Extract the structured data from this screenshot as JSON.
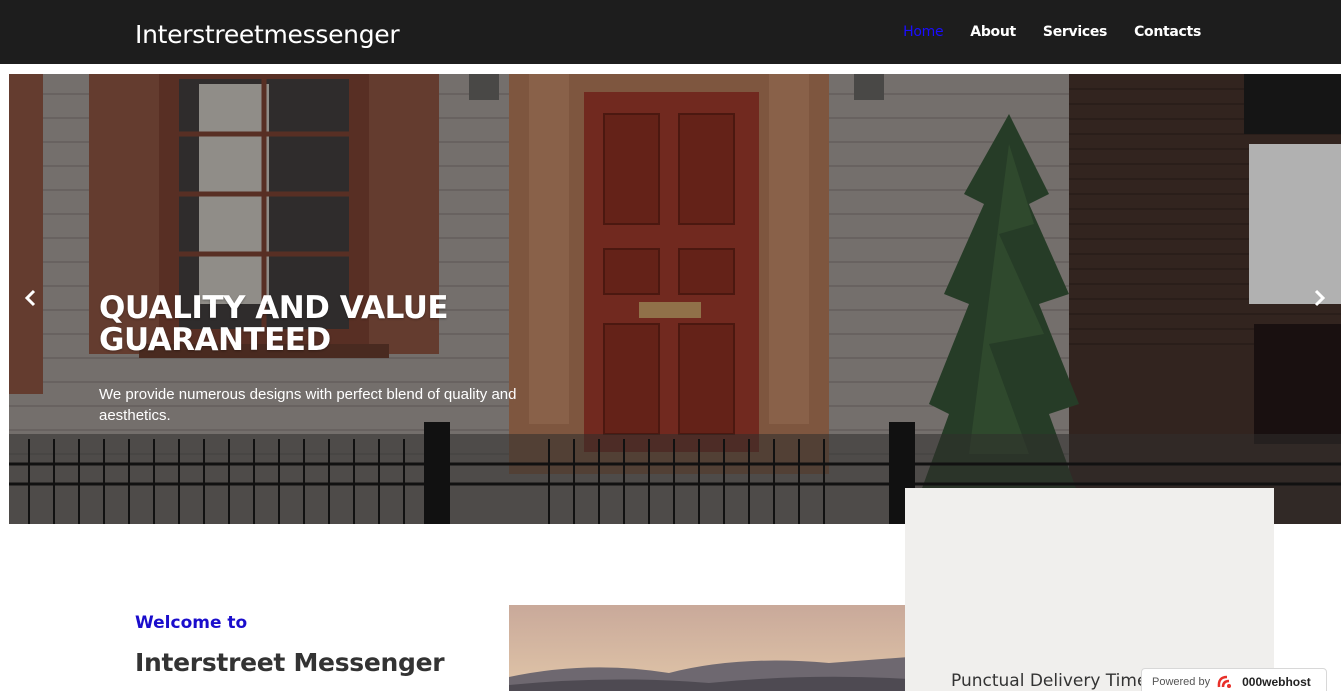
{
  "navbar": {
    "brand": "Interstreetmessenger",
    "links": [
      {
        "label": "Home",
        "active": true
      },
      {
        "label": "About",
        "active": false
      },
      {
        "label": "Services",
        "active": false
      },
      {
        "label": "Contacts",
        "active": false
      }
    ]
  },
  "hero": {
    "title": "QUALITY AND VALUE GUARANTEED",
    "text": "We provide numerous designs with perfect blend of quality and aesthetics.",
    "prev_icon": "chevron-left-icon",
    "next_icon": "chevron-right-icon"
  },
  "about": {
    "welcome": "Welcome to",
    "title": "Interstreet Messenger"
  },
  "feature": {
    "title": "Punctual Delivery Time"
  },
  "badge": {
    "powered": "Powered by",
    "host": "000webhost"
  },
  "colors": {
    "navbar_bg": "#1d1d1d",
    "active_link": "#1a0dff",
    "welcome_text": "#1a0dcc",
    "feature_card_bg": "#f0efed"
  }
}
